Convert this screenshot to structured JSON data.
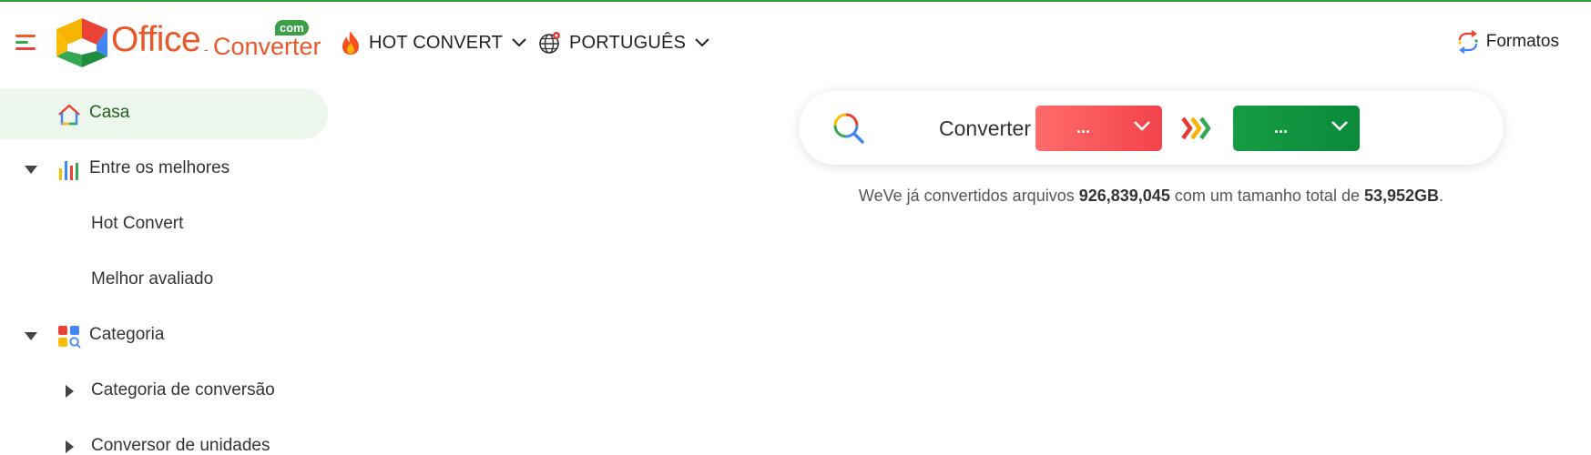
{
  "brand": {
    "name_main": "Office",
    "name_dash": "-",
    "name_sub": "Converter",
    "badge": "com"
  },
  "nav": {
    "hot_convert": "HOT CONVERT",
    "language": "PORTUGUÊS",
    "formats": "Formatos"
  },
  "sidebar": {
    "items": [
      {
        "label": "Casa",
        "icon": "home-icon",
        "active": true
      },
      {
        "label": "Entre os melhores",
        "icon": "bar-chart-icon",
        "expanded": true
      },
      {
        "label": "Hot Convert"
      },
      {
        "label": "Melhor avaliado"
      },
      {
        "label": "Categoria",
        "icon": "category-icon",
        "expanded": true
      },
      {
        "label": "Categoria de conversão",
        "collapsed": true
      },
      {
        "label": "Conversor de unidades",
        "collapsed": true
      }
    ]
  },
  "converter": {
    "label": "Converter",
    "from_value": "...",
    "to_value": "...",
    "colors": {
      "from": "#f2434b",
      "to": "#0a8a3a"
    }
  },
  "stats": {
    "prefix": "WeVe já convertidos arquivos",
    "files_count": "926,839,045",
    "middle": "com um tamanho total de",
    "total_size": "53,952GB",
    "suffix": "."
  },
  "colors": {
    "accent_orange": "#e8582b",
    "accent_green": "#3a9f47",
    "active_bg": "#edf6ec"
  }
}
